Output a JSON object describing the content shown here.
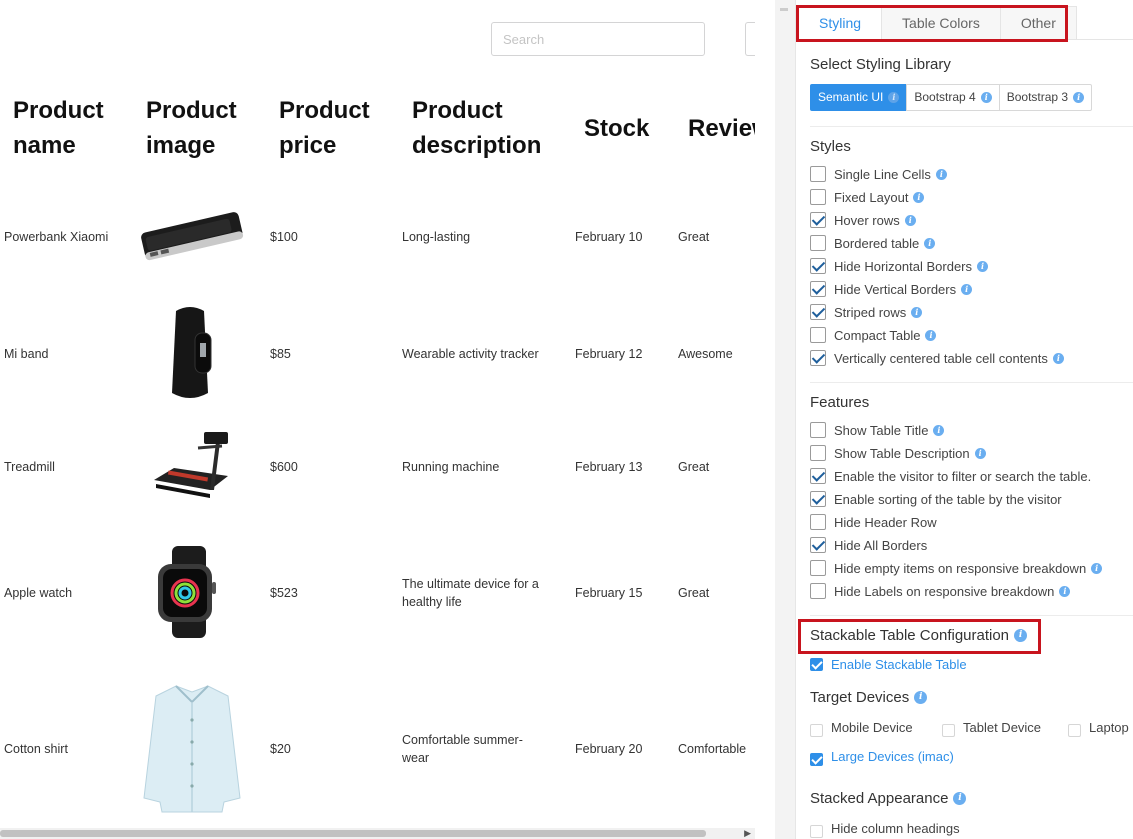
{
  "search": {
    "placeholder": "Search"
  },
  "table": {
    "columns": [
      {
        "l1": "Product",
        "l2": "name"
      },
      {
        "l1": "Product",
        "l2": "image"
      },
      {
        "l1": "Product",
        "l2": "price"
      },
      {
        "l1": "Product",
        "l2": "description"
      },
      {
        "l1": "Stock",
        "l2": ""
      },
      {
        "l1": "Review",
        "l2": ""
      }
    ],
    "rows": [
      {
        "name": "Powerbank Xiaomi",
        "price": "$100",
        "desc": "Long-lasting",
        "desc2": "",
        "stock": "February 10",
        "review": "Great",
        "image": "powerbank"
      },
      {
        "name": "Mi band",
        "price": "$85",
        "desc": "Wearable activity tracker",
        "desc2": "",
        "stock": "February 12",
        "review": "Awesome",
        "image": "fitness-band"
      },
      {
        "name": "Treadmill",
        "price": "$600",
        "desc": "Running machine",
        "desc2": "",
        "stock": "February 13",
        "review": "Great",
        "image": "treadmill"
      },
      {
        "name": "Apple watch",
        "price": "$523",
        "desc": "The ultimate device for a",
        "desc2": "healthy life",
        "stock": "February 15",
        "review": "Great",
        "image": "smartwatch"
      },
      {
        "name": "Cotton shirt",
        "price": "$20",
        "desc": "Comfortable summer-",
        "desc2": "wear",
        "stock": "February 20",
        "review": "Comfortable",
        "image": "shirt"
      }
    ]
  },
  "panel": {
    "tabs": [
      "Styling",
      "Table Colors",
      "Other"
    ],
    "styling_library": {
      "title": "Select Styling Library",
      "options": [
        "Semantic UI",
        "Bootstrap 4",
        "Bootstrap 3"
      ],
      "selected": "Semantic UI"
    },
    "styles": {
      "title": "Styles",
      "items": [
        {
          "label": "Single Line Cells",
          "checked": false
        },
        {
          "label": "Fixed Layout",
          "checked": false
        },
        {
          "label": "Hover rows",
          "checked": true
        },
        {
          "label": "Bordered table",
          "checked": false
        },
        {
          "label": "Hide Horizontal Borders",
          "checked": true
        },
        {
          "label": "Hide Vertical Borders",
          "checked": true
        },
        {
          "label": "Striped rows",
          "checked": true
        },
        {
          "label": "Compact Table",
          "checked": false
        },
        {
          "label": "Vertically centered table cell contents",
          "checked": true
        }
      ]
    },
    "features": {
      "title": "Features",
      "items": [
        {
          "label": "Show Table Title",
          "checked": false
        },
        {
          "label": "Show Table Description",
          "checked": false
        },
        {
          "label": "Enable the visitor to filter or search the table.",
          "checked": true
        },
        {
          "label": "Enable sorting of the table by the visitor",
          "checked": true
        },
        {
          "label": "Hide Header Row",
          "checked": false
        },
        {
          "label": "Hide All Borders",
          "checked": true
        },
        {
          "label": "Hide empty items on responsive breakdown",
          "checked": false
        },
        {
          "label": "Hide Labels on responsive breakdown",
          "checked": false
        }
      ]
    },
    "stackable": {
      "title": "Stackable Table Configuration",
      "enable_label": "Enable Stackable Table",
      "enabled": true
    },
    "target_devices": {
      "title": "Target Devices",
      "items": [
        {
          "label": "Mobile Device",
          "checked": false
        },
        {
          "label": "Tablet Device",
          "checked": false
        },
        {
          "label": "Laptop",
          "checked": false
        },
        {
          "label": "Large Devices (imac)",
          "checked": true
        }
      ]
    },
    "stacked_appearance": {
      "title": "Stacked Appearance",
      "items": [
        {
          "label": "Hide column headings",
          "checked": false
        }
      ]
    }
  },
  "colors": {
    "accent": "#2e8fe8",
    "highlight": "#c8141e"
  }
}
